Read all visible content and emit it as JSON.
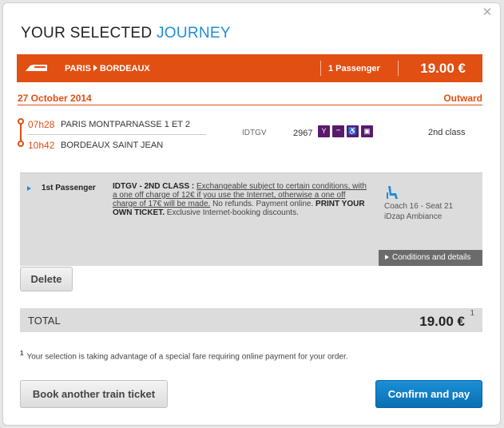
{
  "header": {
    "title_main": "YOUR SELECTED ",
    "title_accent": "JOURNEY",
    "close_icon": "close-icon"
  },
  "journey_bar": {
    "icon": "train-icon",
    "origin": "PARIS",
    "destination": "BORDEAUX",
    "passengers": "1 Passenger",
    "price": "19.00 €",
    "color": "#e14f12"
  },
  "date_row": {
    "date": "27 October 2014",
    "direction": "Outward"
  },
  "segment": {
    "depart_time": "07h28",
    "depart_station": "PARIS MONTPARNASSE 1 ET 2",
    "arrive_time": "10h42",
    "arrive_station": "BORDEAUX SAINT JEAN",
    "operator": "IDTGV",
    "train_number": "2967",
    "amenities": [
      "bar-icon",
      "power-outlet-icon",
      "wheelchair-icon",
      "luggage-icon"
    ],
    "class": "2nd class"
  },
  "passenger": {
    "label": "1st Passenger",
    "fare_title": "IDTGV - 2ND CLASS :",
    "fare_underlined": "Exchangeable subject to certain conditions, with a one off charge of 12€ if you use the Internet, otherwise a one off charge of 17€ will be made.",
    "fare_plain": " No refunds. Payment online. ",
    "fare_bold": "PRINT YOUR OWN TICKET.",
    "fare_tail": " Exclusive Internet-booking discounts.",
    "seat_line1": "Coach 16 - Seat 21",
    "seat_line2": "iDzap Ambiance",
    "conditions_link": "Conditions and details"
  },
  "buttons": {
    "delete": "Delete",
    "book_another": "Book another train ticket",
    "confirm": "Confirm and pay"
  },
  "total": {
    "label": "TOTAL",
    "amount": "19.00 €",
    "note_marker": "1"
  },
  "footnote": {
    "marker": "1",
    "text": "Your selection is taking advantage of a special fare requiring online payment for your order."
  }
}
